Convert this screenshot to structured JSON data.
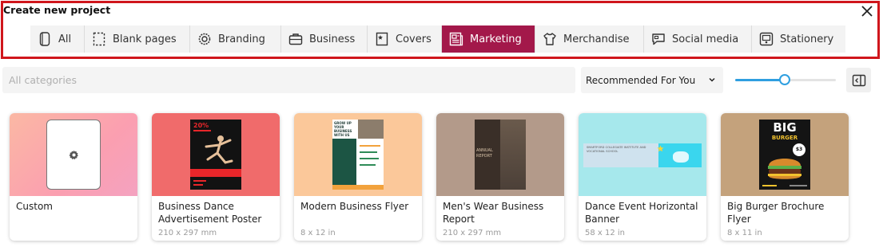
{
  "dialog": {
    "title": "Create new project"
  },
  "tabs": [
    {
      "label": "All",
      "icon": "phone-outline-icon"
    },
    {
      "label": "Blank pages",
      "icon": "dashed-page-icon"
    },
    {
      "label": "Branding",
      "icon": "gear-badge-icon"
    },
    {
      "label": "Business",
      "icon": "briefcase-icon"
    },
    {
      "label": "Covers",
      "icon": "star-cover-icon"
    },
    {
      "label": "Marketing",
      "icon": "newspaper-icon"
    },
    {
      "label": "Merchandise",
      "icon": "tshirt-icon"
    },
    {
      "label": "Social media",
      "icon": "speech-bubble-icon"
    },
    {
      "label": "Stationery",
      "icon": "stationery-icon"
    }
  ],
  "active_tab": "Marketing",
  "filters": {
    "category_placeholder": "All categories",
    "sort_value": "Recommended For You",
    "zoom_level": 0.49
  },
  "cards": [
    {
      "name": "Custom",
      "size": ""
    },
    {
      "name": "Business Dance Advertisement Poster",
      "size": "210 x 297 mm",
      "thumb_text": {
        "headline": "20%",
        "body": ""
      }
    },
    {
      "name": "Modern Business Flyer",
      "size": "8 x 12 in",
      "thumb_text": {
        "headline": "GROW UP YOUR BUSINESS WITH US"
      }
    },
    {
      "name": "Men's Wear Business Report",
      "size": "210 x 297 mm",
      "thumb_text": {
        "headline": "ANNUAL REPORT"
      }
    },
    {
      "name": "Dance Event Horizontal Banner",
      "size": "58 x 12 in",
      "thumb_text": {
        "headline": "SMARTFORD COLLEGIATE INSTITUTE AND VOCATIONAL SCHOOL"
      }
    },
    {
      "name": "Big Burger Brochure Flyer",
      "size": "8 x 11 in",
      "thumb_text": {
        "headline": "BIG",
        "sub": "BURGER",
        "price": "$3"
      }
    }
  ],
  "colors": {
    "frame": "#d0161c",
    "active_tab": "#a3184a",
    "slider": "#2f9fe0"
  }
}
